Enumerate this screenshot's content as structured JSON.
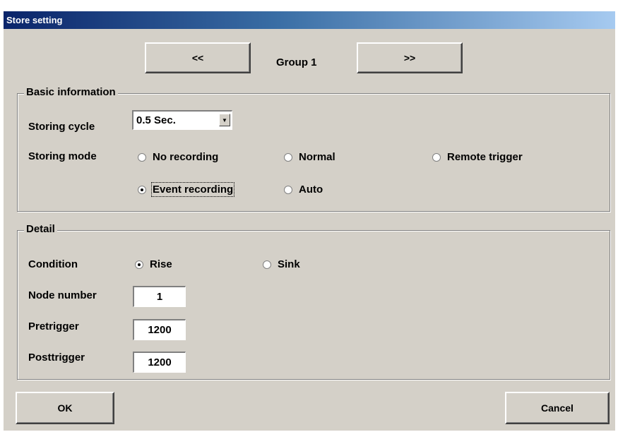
{
  "window": {
    "title": "Store setting"
  },
  "group_nav": {
    "prev_label": "<<",
    "current": "Group 1",
    "next_label": ">>"
  },
  "basic": {
    "legend": "Basic information",
    "storing_cycle_label": "Storing cycle",
    "storing_cycle_value": "0.5 Sec.",
    "storing_mode_label": "Storing mode",
    "modes": {
      "no_recording": "No recording",
      "normal": "Normal",
      "remote_trigger": "Remote trigger",
      "event_recording": "Event recording",
      "auto": "Auto"
    },
    "selected_mode": "Event recording"
  },
  "detail": {
    "legend": "Detail",
    "condition_label": "Condition",
    "conditions": {
      "rise": "Rise",
      "sink": "Sink"
    },
    "selected_condition": "Rise",
    "node_number_label": "Node number",
    "node_number_value": "1",
    "pretrigger_label": "Pretrigger",
    "pretrigger_value": "1200",
    "posttrigger_label": "Posttrigger",
    "posttrigger_value": "1200"
  },
  "footer": {
    "ok_label": "OK",
    "cancel_label": "Cancel"
  },
  "colors": {
    "titlebar": "#0a246a",
    "face": "#d4d0c8"
  }
}
